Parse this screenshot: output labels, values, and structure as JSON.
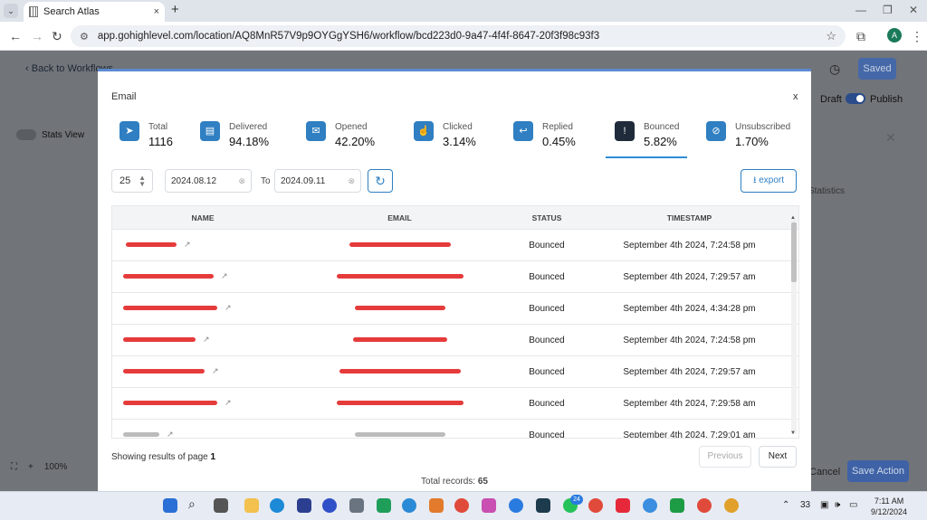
{
  "browser": {
    "tab_title": "Search Atlas",
    "tab_close": "×",
    "new_tab": "+",
    "url": "app.gohighlevel.com/location/AQ8MnR57V9p9OYGgYSH6/workflow/bcd223d0-9a47-4f4f-8647-20f3f98c93f3",
    "profile_initial": "A"
  },
  "app": {
    "back_label": "Back to Workflows",
    "saved_label": "Saved",
    "draft_label": "Draft",
    "publish_label": "Publish",
    "stats_view_label": "Stats View",
    "statistics_label": "Statistics",
    "zoom_level": "100%",
    "cancel_label": "Cancel",
    "save_action_label": "Save Action"
  },
  "modal": {
    "title": "Email",
    "close": "x",
    "stats": [
      {
        "label": "Total",
        "value": "1116",
        "icon": "send-icon",
        "active": false
      },
      {
        "label": "Delivered",
        "value": "94.18%",
        "icon": "inbox-icon",
        "active": false
      },
      {
        "label": "Opened",
        "value": "42.20%",
        "icon": "open-envelope-icon",
        "active": false
      },
      {
        "label": "Clicked",
        "value": "3.14%",
        "icon": "pointer-click-icon",
        "active": false
      },
      {
        "label": "Replied",
        "value": "0.45%",
        "icon": "reply-icon",
        "active": false
      },
      {
        "label": "Bounced",
        "value": "5.82%",
        "icon": "alert-circle-icon",
        "active": true
      },
      {
        "label": "Unsubscribed",
        "value": "1.70%",
        "icon": "unsubscribe-icon",
        "active": false
      }
    ],
    "filters": {
      "page_size": "25",
      "date_from": "2024.08.12",
      "to_label": "To",
      "date_to": "2024.09.11",
      "export_label": "export"
    },
    "table": {
      "columns": [
        "NAME",
        "EMAIL",
        "STATUS",
        "TIMESTAMP"
      ],
      "rows": [
        {
          "status": "Bounced",
          "timestamp": "September 4th 2024, 7:24:58 pm"
        },
        {
          "status": "Bounced",
          "timestamp": "September 4th 2024, 7:29:57 am"
        },
        {
          "status": "Bounced",
          "timestamp": "September 4th 2024, 4:34:28 pm"
        },
        {
          "status": "Bounced",
          "timestamp": "September 4th 2024, 7:24:58 pm"
        },
        {
          "status": "Bounced",
          "timestamp": "September 4th 2024, 7:29:57 am"
        },
        {
          "status": "Bounced",
          "timestamp": "September 4th 2024, 7:29:58 am"
        },
        {
          "status": "Bounced",
          "timestamp": "September 4th 2024, 7:29:01 am"
        }
      ]
    },
    "pagination": {
      "showing_prefix": "Showing results of page",
      "page": "1",
      "previous_label": "Previous",
      "next_label": "Next",
      "total_label": "Total records:",
      "total_count": "65"
    }
  },
  "taskbar": {
    "weather_temp": "33",
    "time": "7:11 AM",
    "date": "9/12/2024",
    "whatsapp_badge": "24"
  }
}
